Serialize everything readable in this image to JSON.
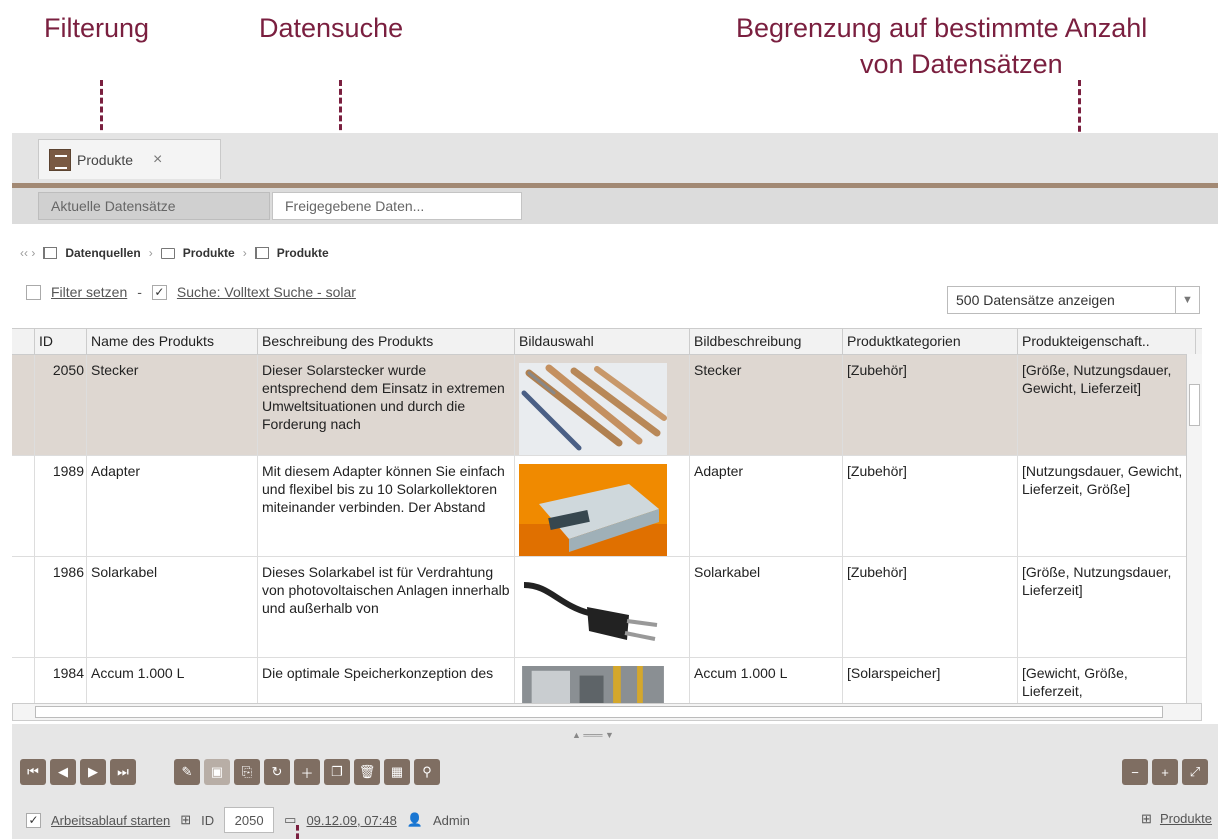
{
  "annotations": {
    "filter": "Filterung",
    "search": "Datensuche",
    "limit_line1": "Begrenzung auf bestimmte Anzahl",
    "limit_line2": "von Datensätzen"
  },
  "tab": {
    "label": "Produkte",
    "close": "×"
  },
  "subtabs": [
    "Aktuelle Datensätze",
    "Freigegebene Daten..."
  ],
  "breadcrumb": [
    "Datenquellen",
    "Produkte",
    "Produkte"
  ],
  "filter": {
    "label": "Filter setzen",
    "separator": "-",
    "search_label": "Suche: Volltext Suche - solar"
  },
  "limit": {
    "value": "500 Datensätze anzeigen"
  },
  "table": {
    "columns": [
      "ID",
      "Name des Produkts",
      "Beschreibung des Produkts",
      "Bildauswahl",
      "Bildbeschreibung",
      "Produktkategorien",
      "Produkteigenschaft.."
    ],
    "rows": [
      {
        "id": "2050",
        "name": "Stecker",
        "desc": "Dieser Solarstecker wurde entsprechend dem Einsatz in extremen Umweltsituationen und durch die Forderung nach",
        "img": "connector-pins-photo",
        "imgdesc": "Stecker",
        "cat": "[Zubehör]",
        "props": "[Größe, Nutzungsdauer, Gewicht, Lieferzeit]"
      },
      {
        "id": "1989",
        "name": "Adapter",
        "desc": "Mit diesem Adapter können Sie einfach und flexibel bis zu 10 Solarkollektoren miteinander verbinden. Der Abstand",
        "img": "adapter-device-photo",
        "imgdesc": "Adapter",
        "cat": "[Zubehör]",
        "props": "[Nutzungsdauer, Gewicht, Lieferzeit, Größe]"
      },
      {
        "id": "1986",
        "name": "Solarkabel",
        "desc": "Dieses Solarkabel ist für Verdrahtung von photovoltaischen Anlagen innerhalb und außerhalb von",
        "img": "power-plug-photo",
        "imgdesc": "Solarkabel",
        "cat": "[Zubehör]",
        "props": "[Größe, Nutzungsdauer, Lieferzeit]"
      },
      {
        "id": "1984",
        "name": "Accum 1.000 L",
        "desc": "Die optimale Speicherkonzeption des",
        "img": "storage-tank-photo",
        "imgdesc": "Accum 1.000 L",
        "cat": "[Solarspeicher]",
        "props": "[Gewicht, Größe, Lieferzeit,"
      }
    ]
  },
  "statusbar": {
    "workflow": "Arbeitsablauf starten",
    "id_label": "ID",
    "id_value": "2050",
    "date": "09.12.09, 07:48",
    "user": "Admin",
    "right_link": "Produkte"
  },
  "colors": {
    "accent": "#7a1f3f",
    "brand": "#7f6e62",
    "selected_row": "#ded7d1"
  }
}
